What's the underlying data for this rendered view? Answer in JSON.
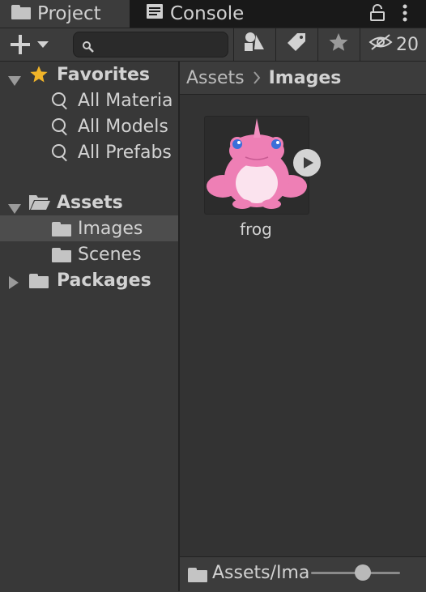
{
  "tabs": {
    "project_label": "Project",
    "console_label": "Console"
  },
  "toolbar": {
    "add_icon": "plus-icon",
    "search_placeholder": "",
    "hidden_count": "20"
  },
  "tree": {
    "favorites": {
      "label": "Favorites",
      "items": [
        "All Materia",
        "All Models",
        "All Prefabs"
      ]
    },
    "assets": {
      "label": "Assets",
      "children": [
        "Images",
        "Scenes"
      ],
      "selected": "Images"
    },
    "packages": {
      "label": "Packages"
    }
  },
  "breadcrumb": {
    "root": "Assets",
    "current": "Images"
  },
  "grid": {
    "items": [
      {
        "name": "frog"
      }
    ]
  },
  "status": {
    "path": "Assets/Ima",
    "zoom": 0.6
  },
  "colors": {
    "background": "#383838",
    "tab_bar": "#191919",
    "selection": "#4d4d4d",
    "favorite_star": "#f0b429",
    "frog_pink": "#ee7fb5"
  }
}
